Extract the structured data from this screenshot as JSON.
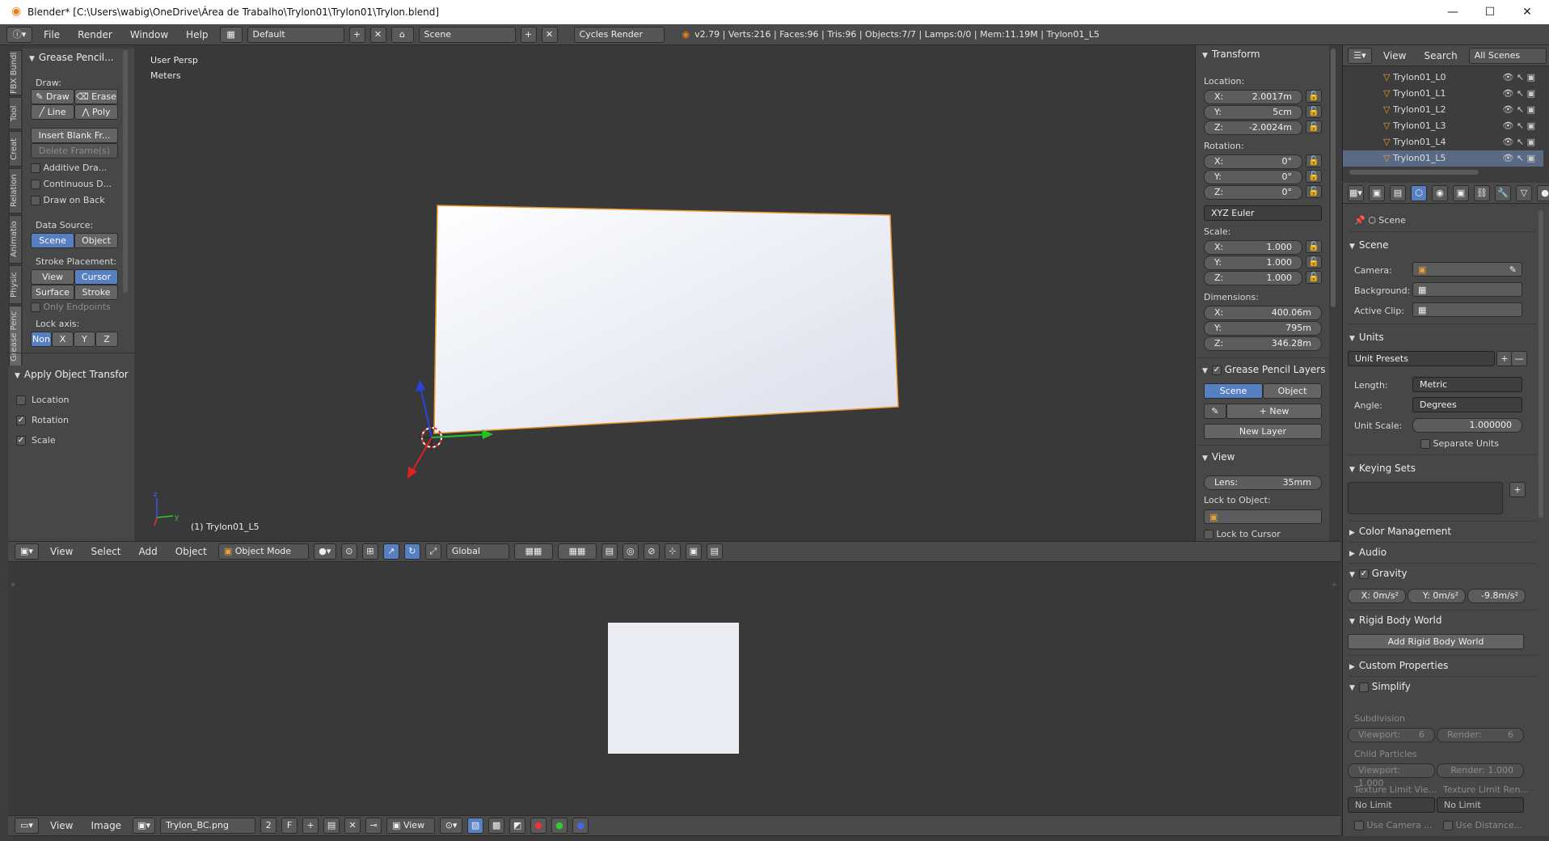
{
  "window": {
    "title": "Blender* [C:\\Users\\wabig\\OneDrive\\Área de Trabalho\\Trylon01\\Trylon01\\Trylon.blend]",
    "minimize": "—",
    "maximize": "☐",
    "close": "✕"
  },
  "menubar": {
    "menus": [
      "File",
      "Render",
      "Window",
      "Help"
    ],
    "layout": "Default",
    "scene": "Scene",
    "engine": "Cycles Render",
    "stats": "v2.79 | Verts:216 | Faces:96 | Tris:96 | Objects:7/7 | Lamps:0/0 | Mem:11.19M | Trylon01_L5"
  },
  "tool_tabs": [
    "FBX Bundl",
    "Tool",
    "Creat",
    "Relation",
    "Animatio",
    "Physic",
    "Grease Penc"
  ],
  "grease_panel": {
    "title": "Grease Pencil...",
    "draw_label": "Draw:",
    "draw": "Draw",
    "erase": "Erase",
    "line": "Line",
    "poly": "Poly",
    "insert_blank": "Insert Blank Fr...",
    "delete_frames": "Delete Frame(s)",
    "additive": "Additive Dra...",
    "continuous": "Continuous D...",
    "draw_on_back": "Draw on Back",
    "data_source_label": "Data Source:",
    "scene": "Scene",
    "object": "Object",
    "stroke_placement_label": "Stroke Placement:",
    "view": "View",
    "cursor": "Cursor",
    "surface": "Surface",
    "stroke": "Stroke",
    "only_endpoints": "Only Endpoints",
    "lock_axis_label": "Lock axis:",
    "lock_none": "Non",
    "lock_x": "X",
    "lock_y": "Y",
    "lock_z": "Z"
  },
  "apply_panel": {
    "title": "Apply Object Transfor",
    "location": "Location",
    "rotation": "Rotation",
    "scale": "Scale"
  },
  "viewport": {
    "persp": "User Persp",
    "units": "Meters",
    "object_label": "(1) Trylon01_L5"
  },
  "viewport_header": {
    "view": "View",
    "select": "Select",
    "add": "Add",
    "object": "Object",
    "mode": "Object Mode",
    "orientation": "Global"
  },
  "transform_panel": {
    "title": "Transform",
    "location_label": "Location:",
    "loc": [
      {
        "k": "X:",
        "v": "2.0017m"
      },
      {
        "k": "Y:",
        "v": "5cm"
      },
      {
        "k": "Z:",
        "v": "-2.0024m"
      }
    ],
    "rotation_label": "Rotation:",
    "rot": [
      {
        "k": "X:",
        "v": "0°"
      },
      {
        "k": "Y:",
        "v": "0°"
      },
      {
        "k": "Z:",
        "v": "0°"
      }
    ],
    "rot_mode": "XYZ Euler",
    "scale_label": "Scale:",
    "scale": [
      {
        "k": "X:",
        "v": "1.000"
      },
      {
        "k": "Y:",
        "v": "1.000"
      },
      {
        "k": "Z:",
        "v": "1.000"
      }
    ],
    "dimensions_label": "Dimensions:",
    "dims": [
      {
        "k": "X:",
        "v": "400.06m"
      },
      {
        "k": "Y:",
        "v": "795m"
      },
      {
        "k": "Z:",
        "v": "346.28m"
      }
    ],
    "gp_layers_title": "Grease Pencil Layers",
    "gp_scene": "Scene",
    "gp_object": "Object",
    "gp_new": "New",
    "gp_new_layer": "New Layer",
    "view_title": "View",
    "lens_k": "Lens:",
    "lens_v": "35mm",
    "lock_object_label": "Lock to Object:",
    "lock_cursor": "Lock to Cursor"
  },
  "outliner": {
    "view": "View",
    "search": "Search",
    "all_scenes": "All Scenes",
    "items": [
      "Trylon01_L0",
      "Trylon01_L1",
      "Trylon01_L2",
      "Trylon01_L3",
      "Trylon01_L4",
      "Trylon01_L5"
    ]
  },
  "properties": {
    "breadcrumb": "Scene",
    "scene_title": "Scene",
    "camera_label": "Camera:",
    "background_label": "Background:",
    "active_clip_label": "Active Clip:",
    "units_title": "Units",
    "unit_presets": "Unit Presets",
    "length_label": "Length:",
    "length_value": "Metric",
    "angle_label": "Angle:",
    "angle_value": "Degrees",
    "unit_scale_label": "Unit Scale:",
    "unit_scale_value": "1.000000",
    "separate_units": "Separate Units",
    "keying_sets_title": "Keying Sets",
    "color_management": "Color Management",
    "audio": "Audio",
    "gravity": "Gravity",
    "gravity_x": "X: 0m/s²",
    "gravity_y": "Y: 0m/s²",
    "gravity_z": "-9.8m/s²",
    "rigid_body_world": "Rigid Body World",
    "add_rigid_body_world": "Add Rigid Body World",
    "custom_properties": "Custom Properties",
    "simplify": "Simplify",
    "subdivision": "Subdivision",
    "viewport_k": "Viewport:",
    "viewport_v": "6",
    "render_k": "Render:",
    "render_v": "6",
    "child_particles": "Child Particles",
    "cp_viewport": "Viewport: 1.000",
    "cp_render": "Render:  1.000",
    "tex_limit_viewport": "Texture Limit Vie...",
    "tex_limit_render": "Texture Limit Ren...",
    "no_limit_1": "No Limit",
    "no_limit_2": "No Limit",
    "use_camera": "Use Camera ...",
    "use_distance": "Use Distance..."
  },
  "image_editor_header": {
    "view": "View",
    "image": "Image",
    "image_name": "Trylon_BC.png",
    "users": "2",
    "fake": "F",
    "view2": "View"
  }
}
